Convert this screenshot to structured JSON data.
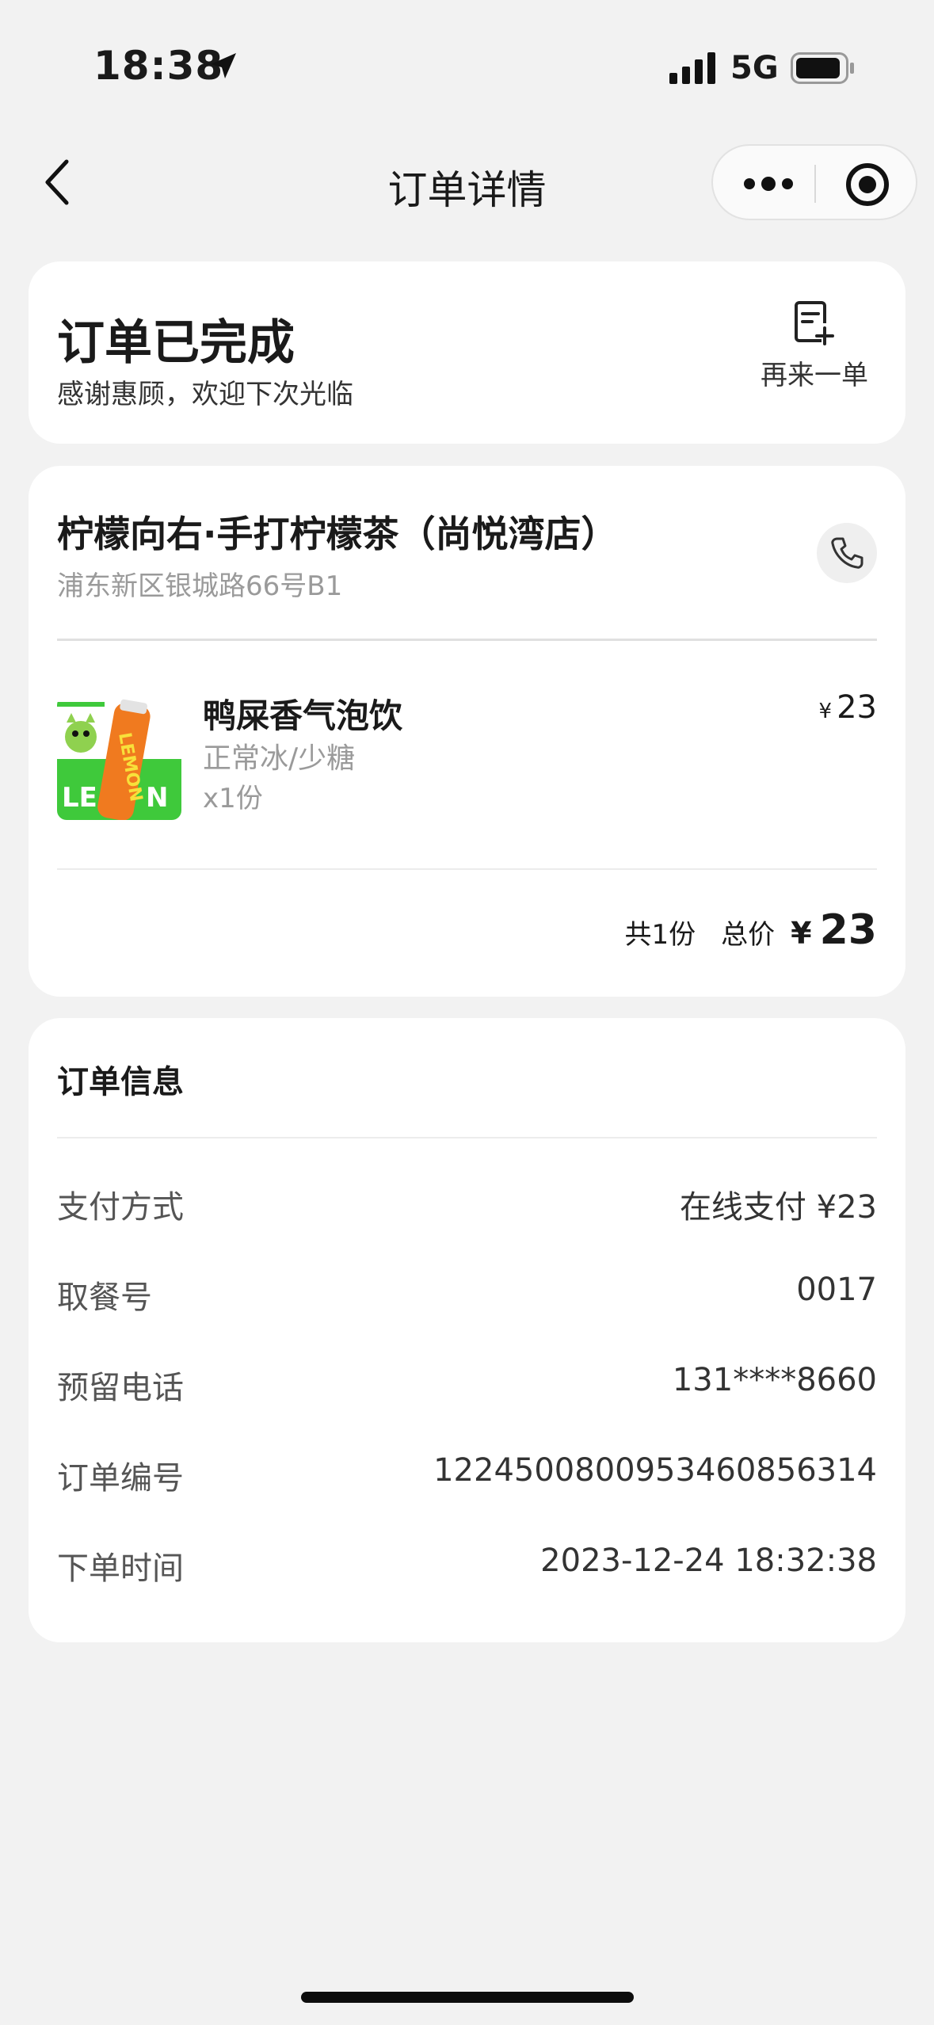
{
  "status_bar": {
    "time": "18:38",
    "network": "5G",
    "icons": [
      "location-arrow-icon",
      "signal-icon",
      "battery-icon"
    ]
  },
  "nav": {
    "title": "订单详情",
    "icons": [
      "chevron-left-icon",
      "more-icon",
      "target-icon"
    ]
  },
  "order_status": {
    "title": "订单已完成",
    "subtitle": "感谢惠顾，欢迎下次光临",
    "reorder_label": "再来一单",
    "icon": "reorder-icon"
  },
  "shop": {
    "name": "柠檬向右·手打柠檬茶（尚悦湾店）",
    "address": "浦东新区银城路66号B1",
    "icon": "phone-icon"
  },
  "items": [
    {
      "name": "鸭屎香气泡饮",
      "spec": "正常冰/少糖",
      "qty": "x1份",
      "currency": "¥",
      "price": "23",
      "image_text": "LEMON"
    }
  ],
  "summary": {
    "count": "共1份",
    "total_label": "总价",
    "currency": "¥",
    "total": "23"
  },
  "order_info": {
    "title": "订单信息",
    "rows": [
      {
        "label": "支付方式",
        "value": "在线支付 ¥23"
      },
      {
        "label": "取餐号",
        "value": "0017"
      },
      {
        "label": "预留电话",
        "value": "131****8660"
      },
      {
        "label": "订单编号",
        "value": "1224500800953460856314"
      },
      {
        "label": "下单时间",
        "value": "2023-12-24 18:32:38"
      }
    ]
  },
  "colors": {
    "background": "#f2f2f2",
    "card": "#ffffff",
    "text": "#1a1a1a",
    "muted": "#9a9a9a",
    "product_green": "#3fc93b",
    "product_orange": "#f07a1f"
  }
}
